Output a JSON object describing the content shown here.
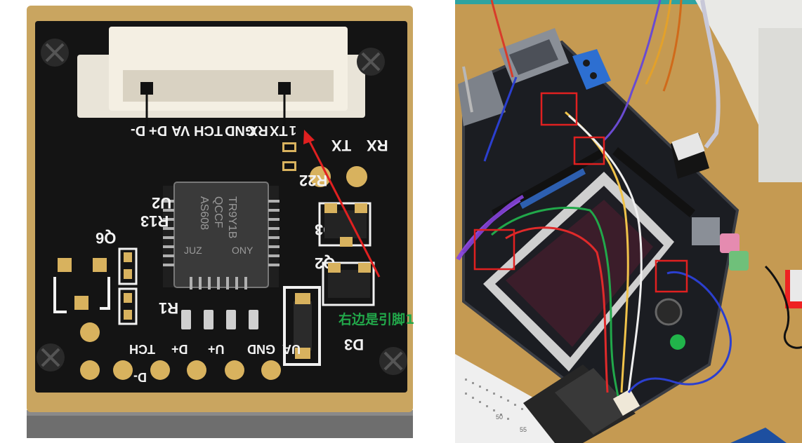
{
  "left_photo": {
    "connector_pin_labels": [
      "D-",
      "D+",
      "VA",
      "TCH",
      "GND",
      "RX",
      "TX"
    ],
    "pin_one_marker": "1",
    "side_labels": {
      "tx": "TX",
      "rx": "RX"
    },
    "component_labels": {
      "u2": "U2",
      "q6": "Q6",
      "r13": "R13",
      "r1": "R1",
      "r22": "R22",
      "q3": "Q3",
      "q2": "Q2",
      "d3": "D3"
    },
    "chip_marking": [
      "AS608",
      "QCCF",
      "TR9Y1B",
      "JUZ",
      "ONY"
    ],
    "bottom_pad_labels": [
      "TCH",
      "D+",
      "U+",
      "GND",
      "UA",
      "D-"
    ],
    "annotation_text": "右边是引脚1",
    "annotation_color": "#22a84a",
    "arrow_color": "#e02020"
  },
  "right_photo": {
    "highlight_box_color": "#e02020",
    "highlight_box_count": 4,
    "breadboard_numbers": [
      "50",
      "55"
    ]
  }
}
